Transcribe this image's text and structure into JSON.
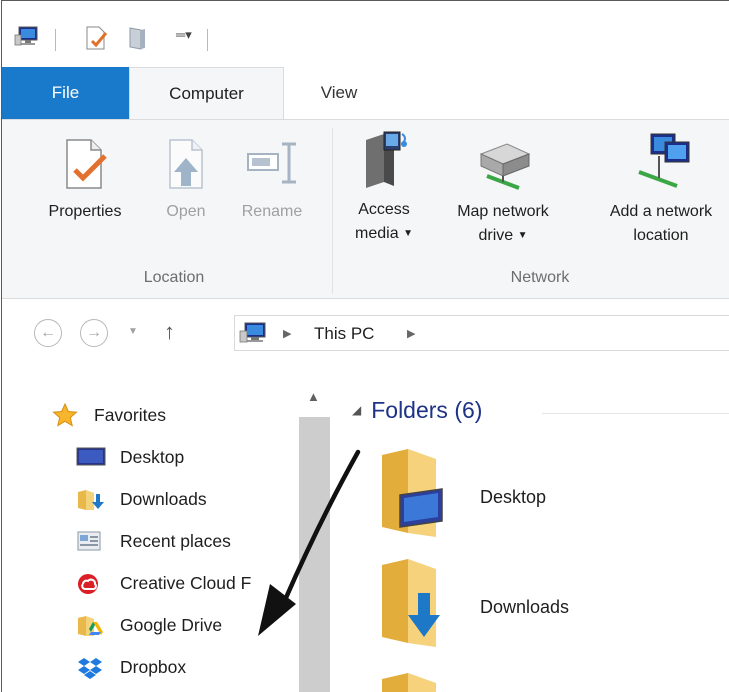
{
  "ribbon": {
    "tabs": {
      "file": "File",
      "computer": "Computer",
      "view": "View"
    },
    "location": {
      "label": "Location",
      "properties": "Properties",
      "open": "Open",
      "rename": "Rename"
    },
    "network": {
      "label": "Network",
      "access_media_line1": "Access",
      "access_media_line2": "media",
      "map_drive_line1": "Map network",
      "map_drive_line2": "drive",
      "add_location_line1": "Add a network",
      "add_location_line2": "location"
    }
  },
  "address_bar": {
    "crumbs": [
      "This PC"
    ]
  },
  "navigation": {
    "favorites_label": "Favorites",
    "items": [
      {
        "label": "Desktop",
        "icon": "desktop-icon"
      },
      {
        "label": "Downloads",
        "icon": "downloads-folder-icon"
      },
      {
        "label": "Recent places",
        "icon": "recent-places-icon"
      },
      {
        "label": "Creative Cloud F",
        "icon": "creative-cloud-icon"
      },
      {
        "label": "Google Drive",
        "icon": "google-drive-icon"
      },
      {
        "label": "Dropbox",
        "icon": "dropbox-icon"
      }
    ]
  },
  "content": {
    "section_title": "Folders (6)",
    "folders": [
      {
        "label": "Desktop",
        "icon": "desktop-folder-icon"
      },
      {
        "label": "Downloads",
        "icon": "downloads-folder-icon"
      }
    ]
  },
  "colors": {
    "file_tab": "#1979ca",
    "section_title": "#1e3287",
    "ribbon_bg": "#f5f6f7",
    "folder_yellow": "#f3d27a"
  }
}
